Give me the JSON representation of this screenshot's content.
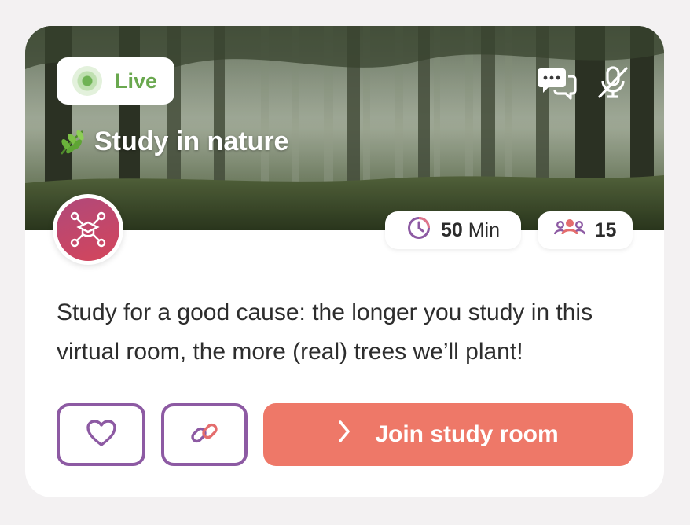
{
  "card": {
    "status_label": "Live",
    "title_emoji": "🌿",
    "title": "Study in nature",
    "duration_value": "50",
    "duration_unit": "Min",
    "participants": "15",
    "description": "Study for a good cause: the longer you study in this virtual room, the more (real) trees we’ll plant!",
    "join_label": "Join study room"
  },
  "icons": {
    "chat": "chat-bubbles-icon",
    "mic_muted": "mic-muted-icon",
    "clock": "clock-icon",
    "group": "people-group-icon",
    "avatar": "network-graduation-cap-icon",
    "heart": "heart-icon",
    "link": "link-icon",
    "chevron": "chevron-right-icon",
    "leaf": "leaf-emoji"
  },
  "colors": {
    "live_green": "#6aa84f",
    "outline_purple": "#8d5aa3",
    "join_coral": "#ee7868",
    "avatar_gradient_start": "#b0497a",
    "avatar_gradient_end": "#d4455b",
    "background": "#f3f1f2"
  }
}
